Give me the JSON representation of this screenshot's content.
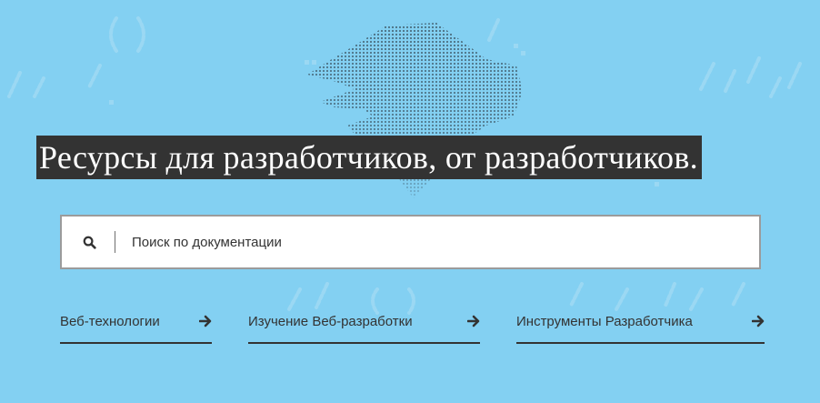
{
  "hero": {
    "title": "Ресурсы для разработчиков, от разработчиков."
  },
  "search": {
    "placeholder": "Поиск по документации",
    "icon": "search-icon"
  },
  "links": [
    {
      "label": "Веб-технологии",
      "icon": "arrow-right-icon"
    },
    {
      "label": "Изучение Веб-разработки",
      "icon": "arrow-right-icon"
    },
    {
      "label": "Инструменты Разработчика",
      "icon": "arrow-right-icon"
    }
  ],
  "colors": {
    "background": "#83d0f2",
    "headline_bg": "#333333",
    "text": "#333333"
  }
}
